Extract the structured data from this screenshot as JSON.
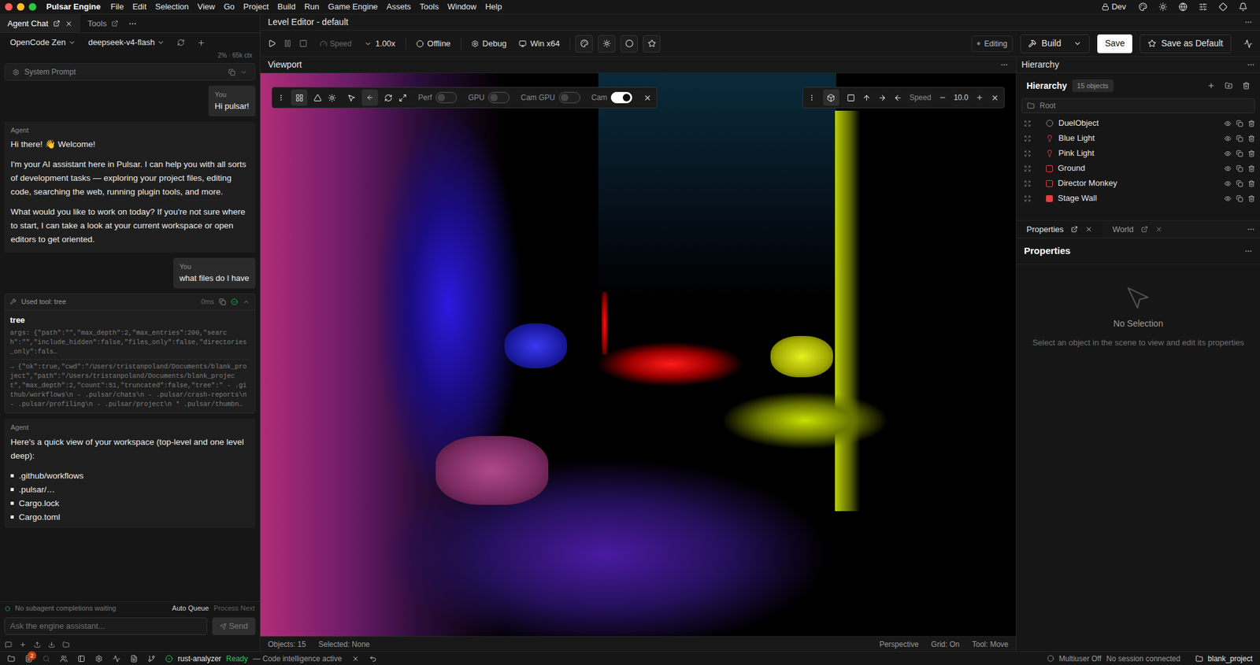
{
  "menu_bar": {
    "app": "Pulsar Engine",
    "items": [
      "File",
      "Edit",
      "Selection",
      "View",
      "Go",
      "Project",
      "Build",
      "Run",
      "Game Engine",
      "Assets",
      "Tools",
      "Window",
      "Help"
    ],
    "profile": "Dev"
  },
  "agent_panel": {
    "tabs": [
      {
        "label": "Agent Chat",
        "selected": true
      },
      {
        "label": "Tools",
        "selected": false
      }
    ],
    "provider": "OpenCode Zen",
    "model": "deepseek-v4-flash",
    "context": "2% · 65k ctx",
    "system_prompt": "System Prompt",
    "messages": [
      {
        "kind": "user",
        "author": "You",
        "text": "Hi pulsar!"
      },
      {
        "kind": "agent",
        "author": "Agent",
        "paragraphs": [
          "Hi there! 👋 Welcome!",
          "I'm your AI assistant here in Pulsar. I can help you with all sorts of development tasks — exploring your project files, editing code, searching the web, running plugin tools, and more.",
          "What would you like to work on today? If you're not sure where to start, I can take a look at your current workspace or open editors to get oriented."
        ]
      },
      {
        "kind": "user",
        "author": "You",
        "text": "what files do I have"
      },
      {
        "kind": "tool",
        "title": "Used tool: tree",
        "duration": "0ms",
        "name": "tree",
        "expanded": true,
        "args": "args: {\"path\":\"\",\"max_depth\":2,\"max_entries\":200,\"search\":\"\",\"include_hidden\":false,\"files_only\":false,\"directories_only\":fals…",
        "result": "→ {\"ok\":true,\"cwd\":\"/Users/tristanpoland/Documents/blank_project\",\"path\":\"/Users/tristanpoland/Documents/blank_project\",\"max_depth\":2,\"count\":51,\"truncated\":false,\"tree\":\"  - .github/workflows\\n  - .pulsar/chats\\n  - .pulsar/crash-reports\\n  - .pulsar/profiling\\n  - .pulsar/project\\n  * .pulsar/thumbn…"
      },
      {
        "kind": "agent",
        "author": "Agent",
        "paragraphs": [
          "Here's a quick view of your workspace (top-level and one level deep):"
        ],
        "list": [
          ".github/workflows",
          ".pulsar/…",
          "Cargo.lock",
          "Cargo.toml"
        ]
      }
    ],
    "queue_status": "No subagent completions waiting",
    "auto_queue": "Auto Queue",
    "process_next": "Process Next",
    "input_placeholder": "Ask the engine assistant...",
    "send": "Send"
  },
  "editor": {
    "title": "Level Editor - default",
    "speed_label": "Speed",
    "speed": "1.00x",
    "network": "Offline",
    "debug": "Debug",
    "platform": "Win x64",
    "mode": "Editing",
    "build": "Build",
    "save": "Save",
    "save_default": "Save as Default"
  },
  "viewport": {
    "tab": "Viewport",
    "toggles": [
      {
        "label": "Perf",
        "on": false
      },
      {
        "label": "GPU",
        "on": false
      },
      {
        "label": "Cam GPU",
        "on": false
      },
      {
        "label": "Cam",
        "on": true
      }
    ],
    "speed_label": "Speed",
    "speed": "10.0",
    "status": {
      "objects": "Objects: 15",
      "selected": "Selected: None",
      "projection": "Perspective",
      "grid": "Grid: On",
      "tool": "Tool: Move"
    }
  },
  "hierarchy": {
    "panel_title": "Hierarchy",
    "title": "Hierarchy",
    "count": "15 objects",
    "root": "Root",
    "items": [
      {
        "name": "DuelObject",
        "kind": "object"
      },
      {
        "name": "Blue Light",
        "kind": "light"
      },
      {
        "name": "Pink Light",
        "kind": "light"
      },
      {
        "name": "Ground",
        "kind": "mesh"
      },
      {
        "name": "Director Monkey",
        "kind": "mesh"
      },
      {
        "name": "Stage Wall",
        "kind": "wall"
      }
    ]
  },
  "properties": {
    "tabs": [
      {
        "label": "Properties",
        "selected": true
      },
      {
        "label": "World",
        "selected": false
      }
    ],
    "title": "Properties",
    "empty_title": "No Selection",
    "empty_text": "Select an object in the scene to view and edit its properties"
  },
  "status_bar": {
    "badge": "2",
    "lsp": "rust-analyzer",
    "lsp_state": "Ready",
    "lsp_detail": "— Code intelligence active",
    "multiuser": "Multiuser Off",
    "session": "No session connected",
    "project": "blank_project"
  }
}
